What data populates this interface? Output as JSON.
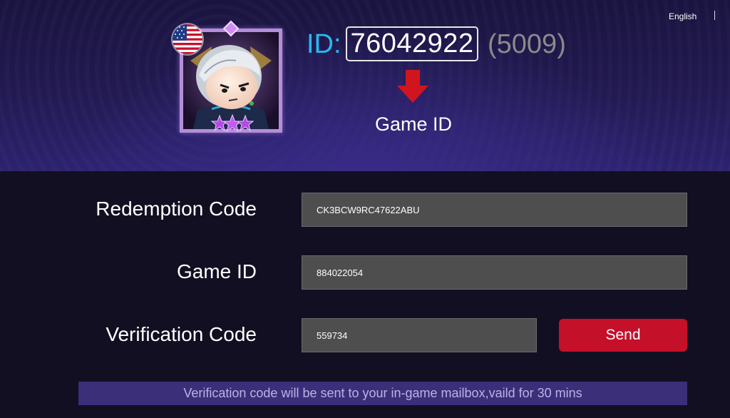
{
  "header": {
    "language": "English",
    "id_label": "ID:",
    "game_id_value": "76042922",
    "server": "(5009)",
    "arrow_caption": "Game ID"
  },
  "form": {
    "redemption_label": "Redemption Code",
    "redemption_value": "CK3BCW9RC47622ABU",
    "game_id_label": "Game ID",
    "game_id_value": "884022054",
    "verification_label": "Verification Code",
    "verification_value": "559734",
    "send_label": "Send"
  },
  "notice": "Verification code will be sent to your in-game mailbox,vaild for 30 mins",
  "colors": {
    "accent_blue": "#29b8ee",
    "send_red": "#c5102a",
    "arrow_red": "#d0151f",
    "notice_bg": "#3b2f7a"
  },
  "icons": [
    "us-flag-icon",
    "down-arrow-icon",
    "star-icon"
  ]
}
